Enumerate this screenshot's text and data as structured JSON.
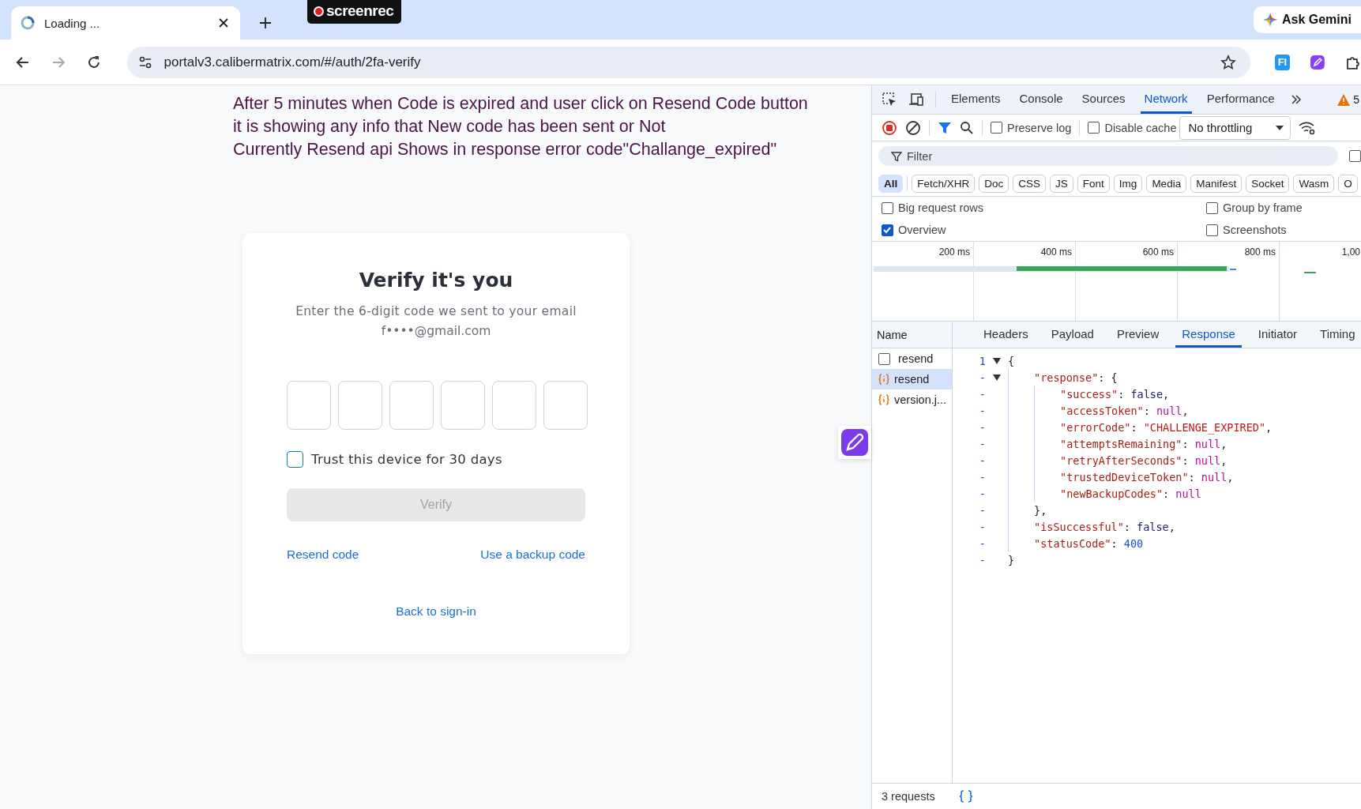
{
  "browser": {
    "tab_title": "Loading ...",
    "recorder_badge": "screenrec",
    "ask_gemini": "Ask Gemini",
    "url": "portalv3.calibermatrix.com/#/auth/2fa-verify",
    "forward_disabled": true,
    "extension_label": "FI"
  },
  "annotation": [
    "After 5 minutes when Code is expired and user click on Resend Code button",
    "it is showing any info that New code has been sent or Not",
    "Currently Resend api Shows in response error code\"Challange_expired\""
  ],
  "card": {
    "title": "Verify it's you",
    "subtitle": "Enter the 6-digit code we sent to your email",
    "email": "f••••@gmail.com",
    "code_fields": [
      {
        "kind": "digit"
      },
      {
        "kind": "digit"
      },
      {
        "kind": "digit"
      },
      {
        "kind": "digit"
      },
      {
        "kind": "digit"
      },
      {
        "kind": "digit"
      }
    ],
    "trust_device": {
      "label": "Trust this device for 30 days",
      "checked": false
    },
    "verify_button": {
      "label": "Verify",
      "disabled": true
    },
    "resend_link": "Resend code",
    "backup_link": "Use a backup code",
    "back_link": "Back to sign-in"
  },
  "devtools": {
    "tabs": [
      {
        "label": "Elements",
        "selected": false
      },
      {
        "label": "Console",
        "selected": false
      },
      {
        "label": "Sources",
        "selected": false
      },
      {
        "label": "Network",
        "selected": true
      },
      {
        "label": "Performance",
        "selected": false
      }
    ],
    "warning_count": "5",
    "preserve_log": {
      "label": "Preserve log",
      "checked": false
    },
    "disable_cache": {
      "label": "Disable cache",
      "checked": false
    },
    "throttling": "No throttling",
    "filter": {
      "placeholder": "Filter"
    },
    "side_checkbox": {
      "checked": false
    },
    "type_filters": [
      {
        "label": "All",
        "selected": true
      },
      {
        "label": "Fetch/XHR",
        "selected": false
      },
      {
        "label": "Doc",
        "selected": false
      },
      {
        "label": "CSS",
        "selected": false
      },
      {
        "label": "JS",
        "selected": false
      },
      {
        "label": "Font",
        "selected": false
      },
      {
        "label": "Img",
        "selected": false
      },
      {
        "label": "Media",
        "selected": false
      },
      {
        "label": "Manifest",
        "selected": false
      },
      {
        "label": "Socket",
        "selected": false
      },
      {
        "label": "Wasm",
        "selected": false
      },
      {
        "label": "O",
        "selected": false
      }
    ],
    "options": [
      {
        "label": "Big request rows",
        "checked": false
      },
      {
        "label": "Group by frame",
        "checked": false
      },
      {
        "label": "Overview",
        "checked": true
      },
      {
        "label": "Screenshots",
        "checked": false
      }
    ],
    "timeline_ticks": [
      "200 ms",
      "400 ms",
      "600 ms",
      "800 ms",
      "1,00"
    ],
    "requests": [
      {
        "name": "resend",
        "kind": "checkbox",
        "selected": false
      },
      {
        "name": "resend",
        "kind": "fetch",
        "selected": true
      },
      {
        "name": "version.j...",
        "kind": "fetch",
        "selected": false
      }
    ],
    "name_header": "Name",
    "detail_tabs": [
      {
        "label": "Headers",
        "selected": false
      },
      {
        "label": "Payload",
        "selected": false
      },
      {
        "label": "Preview",
        "selected": false
      },
      {
        "label": "Response",
        "selected": true
      },
      {
        "label": "Initiator",
        "selected": false
      },
      {
        "label": "Timing",
        "selected": false
      }
    ],
    "response_lines": [
      {
        "gutter": "1",
        "expanded": true,
        "tokens": [
          {
            "kind": "punct",
            "text": "{"
          }
        ],
        "children": [
          {
            "gutter": "-",
            "expanded": true,
            "tokens": [
              {
                "kind": "key",
                "text": "\"response\""
              },
              {
                "kind": "punct",
                "text": ": {"
              }
            ],
            "children": [
              {
                "gutter": "-",
                "tokens": [
                  {
                    "kind": "key",
                    "text": "\"success\""
                  },
                  {
                    "kind": "punct",
                    "text": ": "
                  },
                  {
                    "kind": "bool",
                    "text": "false"
                  },
                  {
                    "kind": "punct",
                    "text": ","
                  }
                ]
              },
              {
                "gutter": "-",
                "tokens": [
                  {
                    "kind": "key",
                    "text": "\"accessToken\""
                  },
                  {
                    "kind": "punct",
                    "text": ": "
                  },
                  {
                    "kind": "null",
                    "text": "null"
                  },
                  {
                    "kind": "punct",
                    "text": ","
                  }
                ]
              },
              {
                "gutter": "-",
                "tokens": [
                  {
                    "kind": "key",
                    "text": "\"errorCode\""
                  },
                  {
                    "kind": "punct",
                    "text": ": "
                  },
                  {
                    "kind": "string",
                    "text": "\"CHALLENGE_EXPIRED\""
                  },
                  {
                    "kind": "punct",
                    "text": ","
                  }
                ]
              },
              {
                "gutter": "-",
                "tokens": [
                  {
                    "kind": "key",
                    "text": "\"attemptsRemaining\""
                  },
                  {
                    "kind": "punct",
                    "text": ": "
                  },
                  {
                    "kind": "null",
                    "text": "null"
                  },
                  {
                    "kind": "punct",
                    "text": ","
                  }
                ]
              },
              {
                "gutter": "-",
                "tokens": [
                  {
                    "kind": "key",
                    "text": "\"retryAfterSeconds\""
                  },
                  {
                    "kind": "punct",
                    "text": ": "
                  },
                  {
                    "kind": "null",
                    "text": "null"
                  },
                  {
                    "kind": "punct",
                    "text": ","
                  }
                ]
              },
              {
                "gutter": "-",
                "tokens": [
                  {
                    "kind": "key",
                    "text": "\"trustedDeviceToken\""
                  },
                  {
                    "kind": "punct",
                    "text": ": "
                  },
                  {
                    "kind": "null",
                    "text": "null"
                  },
                  {
                    "kind": "punct",
                    "text": ","
                  }
                ]
              },
              {
                "gutter": "-",
                "tokens": [
                  {
                    "kind": "key",
                    "text": "\"newBackupCodes\""
                  },
                  {
                    "kind": "punct",
                    "text": ": "
                  },
                  {
                    "kind": "null",
                    "text": "null"
                  }
                ]
              }
            ]
          },
          {
            "gutter": "-",
            "tokens": [
              {
                "kind": "punct",
                "text": "},"
              }
            ]
          },
          {
            "gutter": "-",
            "tokens": [
              {
                "kind": "key",
                "text": "\"isSuccessful\""
              },
              {
                "kind": "punct",
                "text": ": "
              },
              {
                "kind": "bool",
                "text": "false"
              },
              {
                "kind": "punct",
                "text": ","
              }
            ]
          },
          {
            "gutter": "-",
            "tokens": [
              {
                "kind": "key",
                "text": "\"statusCode\""
              },
              {
                "kind": "punct",
                "text": ": "
              },
              {
                "kind": "number",
                "text": "400"
              }
            ]
          }
        ]
      },
      {
        "gutter": "-",
        "tokens": [
          {
            "kind": "punct",
            "text": "}"
          }
        ]
      }
    ],
    "status_text": "3 requests"
  }
}
